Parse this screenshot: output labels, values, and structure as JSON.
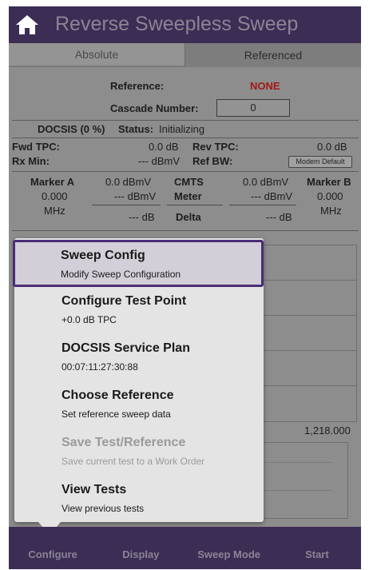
{
  "app": {
    "title": "Reverse Sweepless Sweep"
  },
  "icons": {
    "home": "home-icon"
  },
  "colors": {
    "bar": "#3c2d55",
    "selection_border": "#4b2c76",
    "reference_none": "#a31818"
  },
  "tabs": [
    {
      "label": "Absolute",
      "active": true
    },
    {
      "label": "Referenced",
      "active": false
    }
  ],
  "info": {
    "reference_label": "Reference:",
    "reference_value": "NONE",
    "cascade_label": "Cascade Number:",
    "cascade_value": "0",
    "docsis_label": "DOCSIS (0 %)",
    "status_label": "Status:",
    "status_value": "Initializing"
  },
  "power": {
    "fwd_tpc_label": "Fwd TPC:",
    "fwd_tpc_value": "0.0 dB",
    "rev_tpc_label": "Rev TPC:",
    "rev_tpc_value": "0.0 dB",
    "rx_min_label": "Rx Min:",
    "rx_min_value": "--- dBmV",
    "ref_bw_label": "Ref BW:",
    "ref_bw_button": "Modem Default"
  },
  "markers": {
    "marker_a_label": "Marker A",
    "marker_a_freq": "0.000",
    "marker_a_unit": "MHz",
    "marker_a_dbmv": "0.0 dBmV",
    "marker_a_dbmv2": "--- dBmV",
    "marker_a_db": "--- dB",
    "cmts_label": "CMTS",
    "meter_label": "Meter",
    "delta_label": "Delta",
    "marker_b_dbmv": "0.0 dBmV",
    "marker_b_dbmv2": "--- dBmV",
    "marker_b_db": "--- dB",
    "marker_b_label": "Marker B",
    "marker_b_freq": "0.000",
    "marker_b_unit": "MHz"
  },
  "chart": {
    "x_max_label": "1,218.000"
  },
  "menu": {
    "items": [
      {
        "title": "Sweep Config",
        "subtitle": "Modify Sweep Configuration",
        "selected": true,
        "enabled": true
      },
      {
        "title": "Configure Test Point",
        "subtitle": "+0.0 dB TPC",
        "selected": false,
        "enabled": true
      },
      {
        "title": "DOCSIS Service Plan",
        "subtitle": "00:07:11:27:30:88",
        "selected": false,
        "enabled": true
      },
      {
        "title": "Choose Reference",
        "subtitle": "Set reference sweep data",
        "selected": false,
        "enabled": true
      },
      {
        "title": "Save Test/Reference",
        "subtitle": "Save current test to a Work Order",
        "selected": false,
        "enabled": false
      },
      {
        "title": "View Tests",
        "subtitle": "View previous tests",
        "selected": false,
        "enabled": true
      }
    ]
  },
  "bottombar": {
    "configure": "Configure",
    "display": "Display",
    "sweep_mode": "Sweep Mode",
    "start": "Start"
  }
}
